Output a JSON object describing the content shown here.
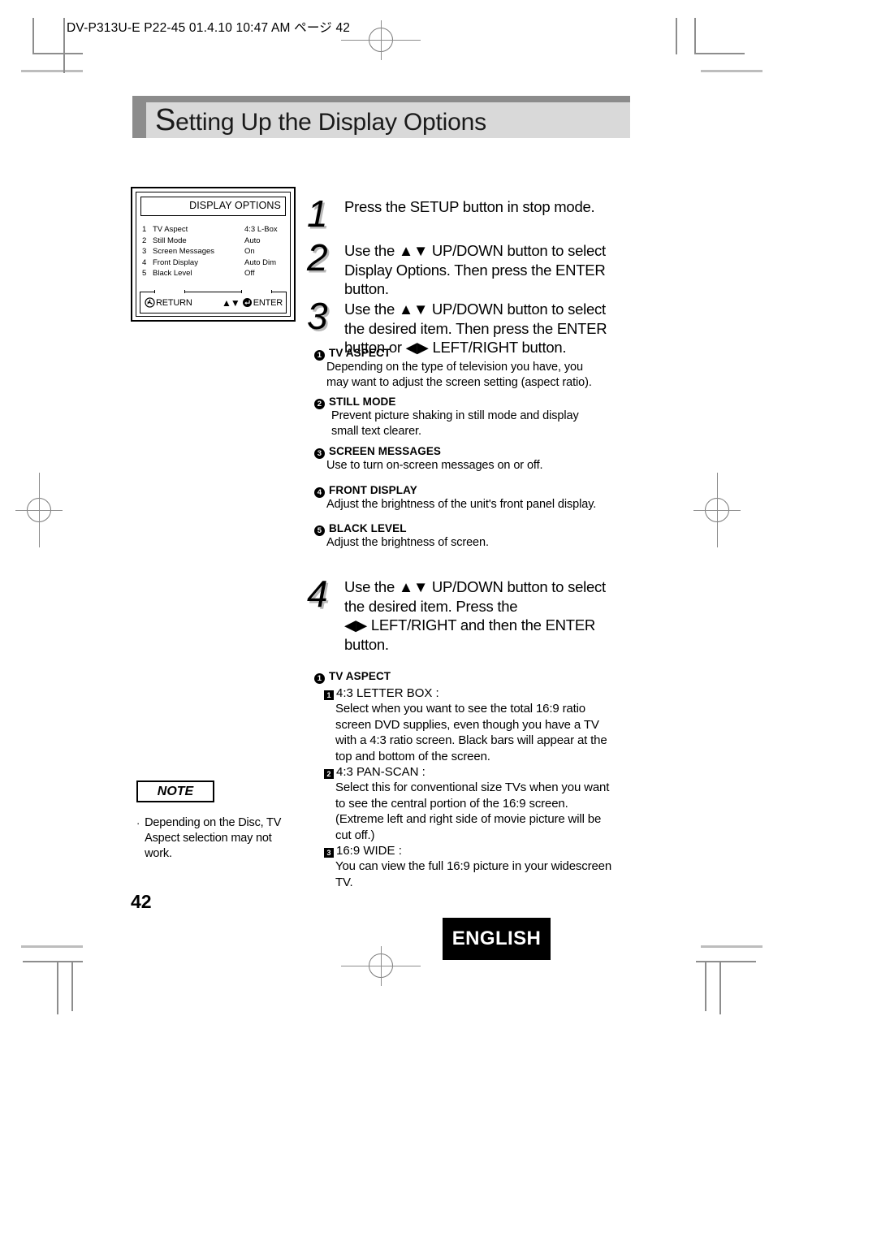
{
  "print_header": {
    "text": "DV-P313U-E P22-45  01.4.10 10:47 AM  ページ 42"
  },
  "title": {
    "initial": "S",
    "rest": "etting Up the Display Options"
  },
  "osd": {
    "screen_title": "DISPLAY OPTIONS",
    "rows": [
      {
        "num": "1",
        "label": "TV Aspect",
        "value": "4:3 L-Box"
      },
      {
        "num": "2",
        "label": "Still Mode",
        "value": "Auto"
      },
      {
        "num": "3",
        "label": "Screen Messages",
        "value": "On"
      },
      {
        "num": "4",
        "label": "Front Display",
        "value": "Auto Dim"
      },
      {
        "num": "5",
        "label": "Black Level",
        "value": "Off"
      }
    ],
    "footer": {
      "return_label": "RETURN",
      "updown_arrows": "▲▼",
      "enter_label": "ENTER"
    }
  },
  "steps": [
    {
      "num": "1",
      "lines": [
        "Press the SETUP button in stop mode."
      ]
    },
    {
      "num": "2",
      "lines": [
        "Use the ▲▼ UP/DOWN button to select",
        "Display Options. Then press the ENTER",
        "button."
      ]
    },
    {
      "num": "3",
      "lines": [
        "Use the ▲▼ UP/DOWN button to select",
        "the desired item. Then press the ENTER",
        "button or ◀▶ LEFT/RIGHT button."
      ]
    },
    {
      "num": "4",
      "lines": [
        "Use the ▲▼ UP/DOWN button to select",
        "the desired item. Press the",
        "   ◀▶ LEFT/RIGHT and then the ENTER",
        "button."
      ]
    }
  ],
  "options": [
    {
      "num": "1",
      "heading": "TV ASPECT",
      "body": [
        "Depending on the type of television you have, you",
        "may want to adjust the screen setting (aspect ratio)."
      ],
      "indent": false
    },
    {
      "num": "2",
      "heading": "STILL MODE",
      "body": [
        "Prevent picture shaking in still mode and display",
        "small text clearer."
      ],
      "indent": true
    },
    {
      "num": "3",
      "heading": "SCREEN MESSAGES",
      "body": [
        "Use to turn on-screen messages on or off."
      ],
      "indent": false
    },
    {
      "num": "4",
      "heading": "FRONT DISPLAY",
      "body": [
        "Adjust the brightness of the unit's front panel display."
      ],
      "indent": false
    },
    {
      "num": "5",
      "heading": "BLACK LEVEL",
      "body": [
        "Adjust the brightness of screen."
      ],
      "indent": false
    }
  ],
  "tv_aspect_detail": {
    "num": "1",
    "heading": "TV ASPECT",
    "items": [
      {
        "num": "1",
        "label": "4:3 LETTER BOX :",
        "body": [
          "Select when you want to see the total 16:9 ratio",
          "screen DVD supplies, even though you have a TV",
          "with a 4:3 ratio screen. Black bars will appear at the",
          "top and bottom of the screen."
        ]
      },
      {
        "num": "2",
        "label": "4:3 PAN-SCAN :",
        "body": [
          "Select this for conventional size TVs when you want",
          "to see the central portion of the 16:9 screen.",
          "(Extreme left and right side of movie picture will be",
          "cut off.)"
        ]
      },
      {
        "num": "3",
        "label": "16:9 WIDE :",
        "body": [
          "You can view the full 16:9 picture in your widescreen TV."
        ]
      }
    ]
  },
  "note": {
    "title": "NOTE",
    "bullet": "·",
    "lines": [
      "Depending on the Disc, TV",
      "Aspect selection may not",
      "work."
    ]
  },
  "footer": {
    "page_number": "42",
    "language": "ENGLISH"
  },
  "colors": {
    "title_band": "#d9d9d9",
    "title_band_edge": "#8c8c8c",
    "badge_bg": "#000000",
    "crop_mark": "#8d8d8d"
  }
}
